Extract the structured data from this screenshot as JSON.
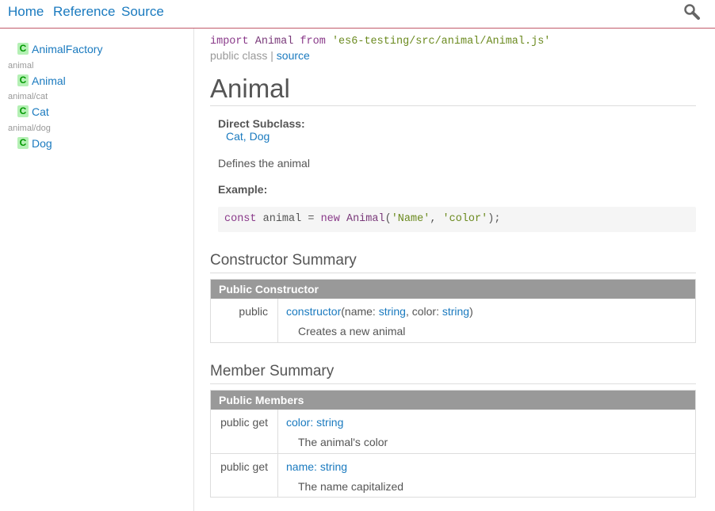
{
  "header": {
    "nav": [
      "Home",
      "Reference",
      "Source"
    ]
  },
  "sidebar": {
    "items": [
      {
        "badge": "C",
        "label": "AnimalFactory"
      },
      {
        "dir": "animal",
        "badge": "C",
        "label": "Animal"
      },
      {
        "dir": "animal/cat",
        "badge": "C",
        "label": "Cat"
      },
      {
        "dir": "animal/dog",
        "badge": "C",
        "label": "Dog"
      }
    ]
  },
  "main": {
    "import": {
      "kw_import": "import",
      "name": "Animal",
      "kw_from": "from",
      "path": "'es6-testing/src/animal/Animal.js'"
    },
    "meta": {
      "prefix": "public class",
      "sep": "|",
      "source_link": "source"
    },
    "title": "Animal",
    "direct_subclass_label": "Direct Subclass:",
    "subclasses": [
      "Cat",
      "Dog"
    ],
    "subclass_sep": ",",
    "description": "Defines the animal",
    "example_label": "Example:",
    "example_code": {
      "kw_const": "const",
      "var": "animal",
      "eq": "=",
      "kw_new": "new",
      "cls": "Animal",
      "open": "(",
      "arg1": "'Name'",
      "comma": ",",
      "arg2": "'color'",
      "close": ");"
    },
    "constructor_summary": {
      "title": "Constructor Summary",
      "header": "Public Constructor",
      "rows": [
        {
          "access": "public",
          "name": "constructor",
          "params_open": "(name: ",
          "type1": "string",
          "mid": ", color: ",
          "type2": "string",
          "params_close": ")",
          "description": "Creates a new animal"
        }
      ]
    },
    "member_summary": {
      "title": "Member Summary",
      "header": "Public Members",
      "rows": [
        {
          "access": "public get",
          "name": "color",
          "sep": ": ",
          "type": "string",
          "description": "The animal's color"
        },
        {
          "access": "public get",
          "name": "name",
          "sep": ": ",
          "type": "string",
          "description": "The name capitalized"
        }
      ]
    }
  }
}
